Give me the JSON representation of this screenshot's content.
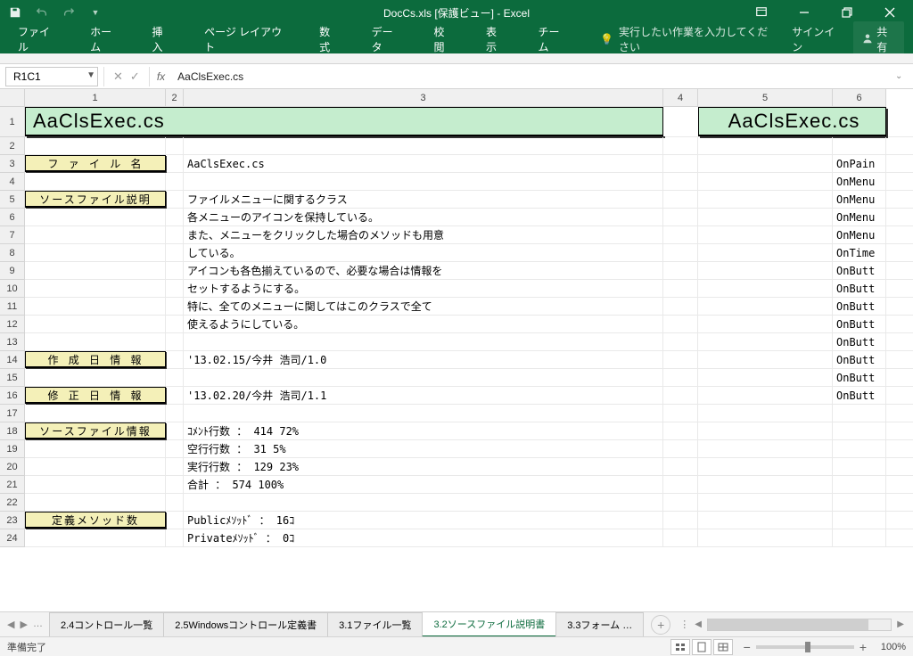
{
  "titlebar": {
    "title": "DocCs.xls [保護ビュー] - Excel"
  },
  "win": {
    "signin": "サインイン",
    "share": "共有"
  },
  "ribbon": {
    "tabs": [
      "ファイル",
      "ホーム",
      "挿入",
      "ページ レイアウト",
      "数式",
      "データ",
      "校閲",
      "表示",
      "チーム"
    ],
    "tellme": "実行したい作業を入力してください"
  },
  "formula": {
    "namebox": "R1C1",
    "content": "AaClsExec.cs"
  },
  "cols": [
    "1",
    "2",
    "3",
    "4",
    "5",
    "6"
  ],
  "rows": [
    "1",
    "2",
    "3",
    "4",
    "5",
    "6",
    "7",
    "8",
    "9",
    "10",
    "11",
    "12",
    "13",
    "14",
    "15",
    "16",
    "17",
    "18",
    "19",
    "20",
    "21",
    "22",
    "23",
    "24"
  ],
  "sheet": {
    "header_left": "AaClsExec.cs",
    "header_right": "AaClsExec.cs",
    "labels": {
      "file": "フ ァ イ ル 名",
      "src_desc": "ソースファイル説明",
      "created": "作 成 日 情 報",
      "modified": "修 正 日 情 報",
      "src_info": "ソースファイル情報",
      "method_cnt": "定義メソッド数"
    },
    "values": {
      "file": "AaClsExec.cs",
      "desc": [
        "ファイルメニューに関するクラス",
        "各メニューのアイコンを保持している。",
        "また、メニューをクリックした場合のメソッドも用意",
        "している。",
        "アイコンも各色揃えているので、必要な場合は情報を",
        "セットするようにする。",
        "特に、全てのメニューに関してはこのクラスで全て",
        "使えるようにしている。"
      ],
      "created": "'13.02.15/今井 浩司/1.0",
      "modified": "'13.02.20/今井 浩司/1.1",
      "info": [
        "ｺﾒﾝﾄ行数 ：   414    72%",
        "空行行数 ：    31     5%",
        "実行行数 ：   129    23%",
        "合計     ：   574   100%"
      ],
      "methods": [
        "Publicﾒｿｯﾄﾞ     ：  16ｺ",
        "Privateﾒｿｯﾄﾞ    ：   0ｺ"
      ],
      "right_col": [
        "OnPain",
        "OnMenu",
        "OnMenu",
        "OnMenu",
        "OnMenu",
        "OnTime",
        "OnButt",
        "OnButt",
        "OnButt",
        "OnButt",
        "OnButt",
        "OnButt",
        "OnButt",
        "OnButt"
      ]
    }
  },
  "tabs": {
    "items": [
      "2.4コントロール一覧",
      "2.5Windowsコントロール定義書",
      "3.1ファイル一覧",
      "3.2ソースファイル説明書",
      "3.3フォーム …"
    ],
    "active": 3,
    "ellipsis": "…"
  },
  "status": {
    "ready": "準備完了",
    "zoom": "100%"
  }
}
